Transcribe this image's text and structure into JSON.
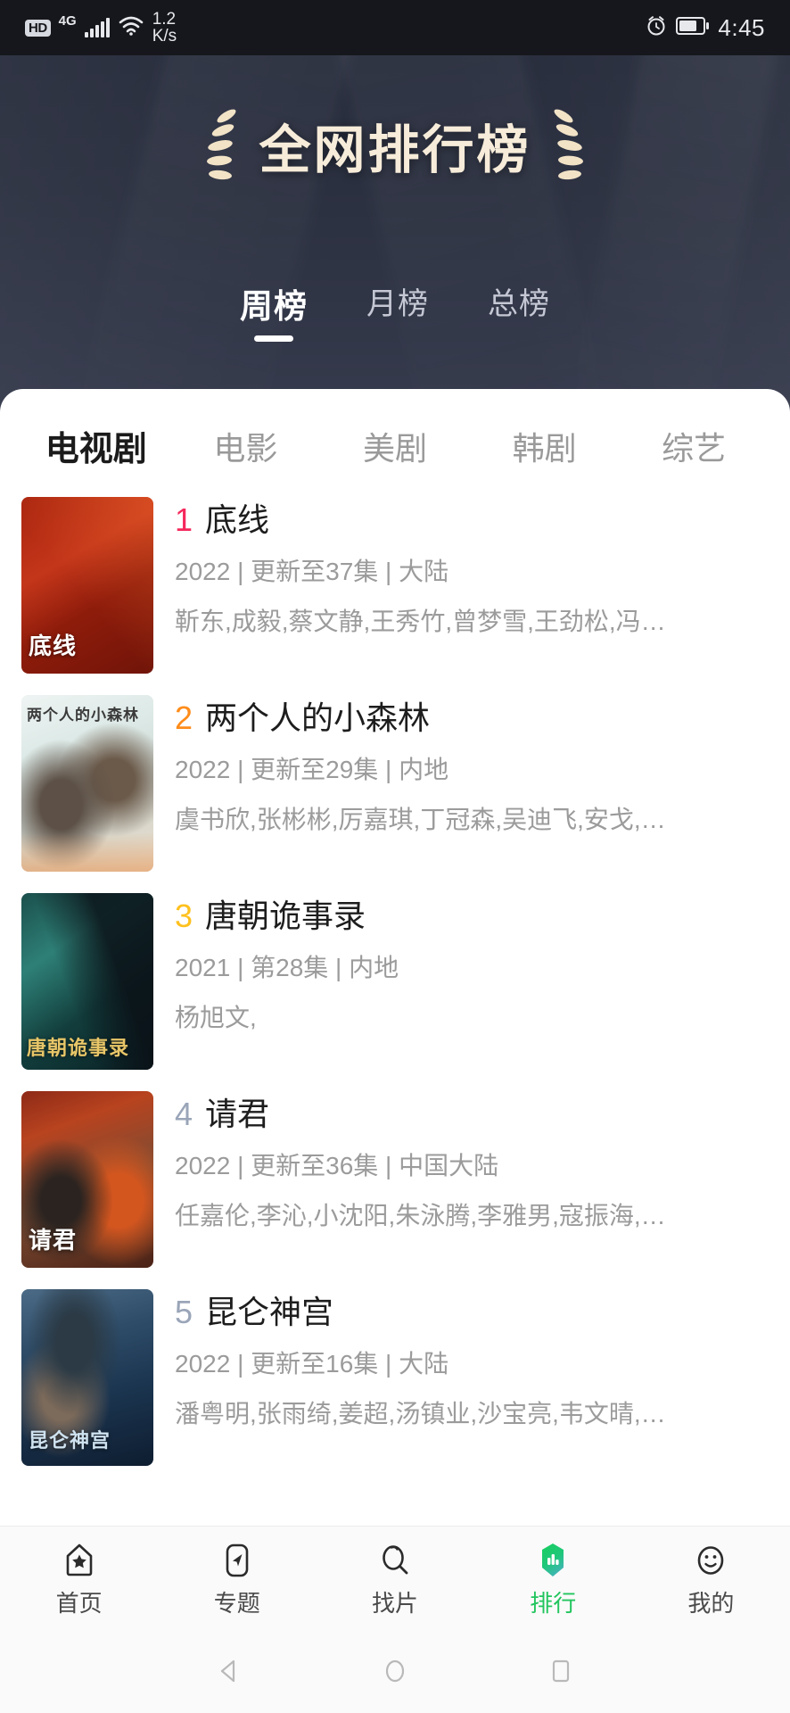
{
  "statusbar": {
    "hd_label": "HD",
    "network_label": "4G",
    "speed_value": "1.2",
    "speed_unit": "K/s",
    "time": "4:45",
    "icons": [
      "hd-icon",
      "signal-bars-icon",
      "wifi-icon",
      "alarm-icon",
      "battery-icon"
    ]
  },
  "hero": {
    "title": "全网排行榜",
    "title_color": "#f7ecd9",
    "background_color": "#2b3040",
    "period_tabs": [
      {
        "label": "周榜",
        "active": true
      },
      {
        "label": "月榜",
        "active": false
      },
      {
        "label": "总榜",
        "active": false
      }
    ]
  },
  "category_tabs": [
    {
      "label": "电视剧",
      "active": true
    },
    {
      "label": "电影",
      "active": false
    },
    {
      "label": "美剧",
      "active": false
    },
    {
      "label": "韩剧",
      "active": false
    },
    {
      "label": "综艺",
      "active": false
    }
  ],
  "rank_colors": {
    "first": "#f5275b",
    "second": "#ff8c1a",
    "third": "#ffc11e",
    "other": "#9aa5b8"
  },
  "ranking": [
    {
      "rank": "1",
      "rank_color": "#f5275b",
      "title": "底线",
      "year": "2022",
      "episode": "更新至37集",
      "region": "大陆",
      "meta": "2022 | 更新至37集 | 大陆",
      "cast": "靳东,成毅,蔡文静,王秀竹,曾梦雪,王劲松,冯…",
      "poster_title": "底线"
    },
    {
      "rank": "2",
      "rank_color": "#ff8c1a",
      "title": "两个人的小森林",
      "year": "2022",
      "episode": "更新至29集",
      "region": "内地",
      "meta": "2022 | 更新至29集 | 内地",
      "cast": "虞书欣,张彬彬,厉嘉琪,丁冠森,吴迪飞,安戈,…",
      "poster_title": "两个人的小森林"
    },
    {
      "rank": "3",
      "rank_color": "#ffc11e",
      "title": "唐朝诡事录",
      "year": "2021",
      "episode": "第28集",
      "region": "内地",
      "meta": "2021 | 第28集 | 内地",
      "cast": "杨旭文,",
      "poster_title": "唐朝诡事录"
    },
    {
      "rank": "4",
      "rank_color": "#9aa5b8",
      "title": "请君",
      "year": "2022",
      "episode": "更新至36集",
      "region": "中国大陆",
      "meta": "2022 | 更新至36集 | 中国大陆",
      "cast": "任嘉伦,李沁,小沈阳,朱泳腾,李雅男,寇振海,…",
      "poster_title": "请君"
    },
    {
      "rank": "5",
      "rank_color": "#9aa5b8",
      "title": "昆仑神宫",
      "year": "2022",
      "episode": "更新至16集",
      "region": "大陆",
      "meta": "2022 | 更新至16集 | 大陆",
      "cast": "潘粤明,张雨绮,姜超,汤镇业,沙宝亮,韦文晴,…",
      "poster_title": "昆仑神宫"
    }
  ],
  "bottom_nav": {
    "active_color": "#22c55e",
    "items": [
      {
        "label": "首页",
        "icon": "home-star-icon",
        "active": false
      },
      {
        "label": "专题",
        "icon": "compass-arrow-icon",
        "active": false
      },
      {
        "label": "找片",
        "icon": "search-icon",
        "active": false
      },
      {
        "label": "排行",
        "icon": "ranking-chart-icon",
        "active": true
      },
      {
        "label": "我的",
        "icon": "smiley-face-icon",
        "active": false
      }
    ]
  },
  "android_nav": {
    "back": "back-triangle-icon",
    "home": "home-circle-icon",
    "recents": "recents-square-icon"
  }
}
